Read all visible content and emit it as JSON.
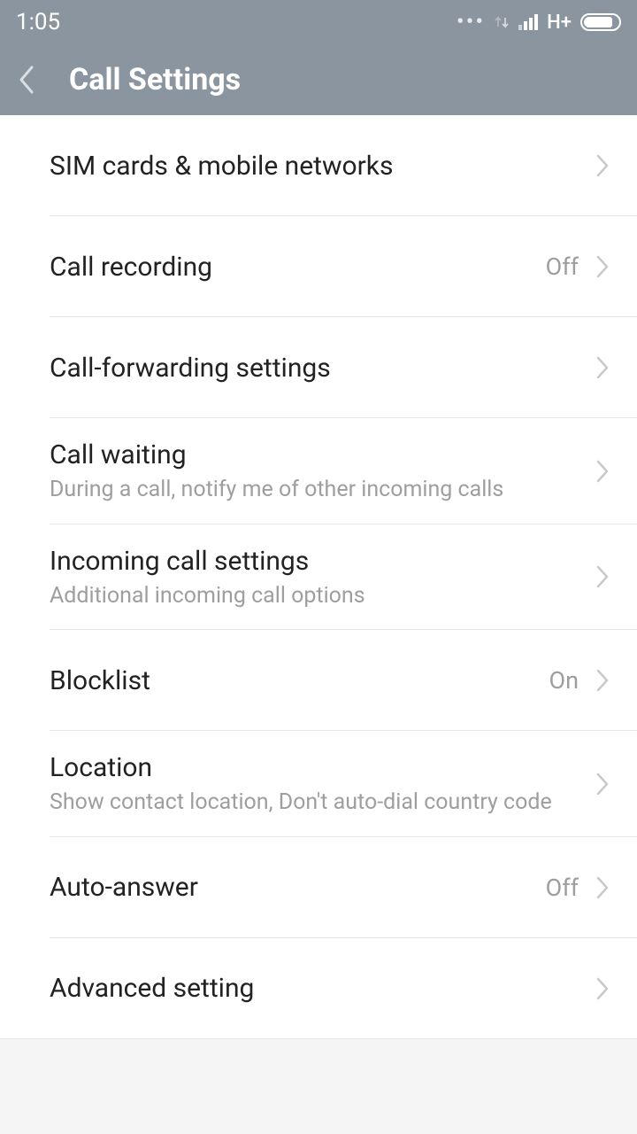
{
  "statusbar": {
    "time": "1:05",
    "net": "H+"
  },
  "header": {
    "title": "Call Settings"
  },
  "rows": [
    {
      "title": "SIM cards & mobile networks",
      "sub": "",
      "value": ""
    },
    {
      "title": "Call recording",
      "sub": "",
      "value": "Off"
    },
    {
      "title": "Call-forwarding settings",
      "sub": "",
      "value": ""
    },
    {
      "title": "Call waiting",
      "sub": "During a call, notify me of other incoming calls",
      "value": ""
    },
    {
      "title": "Incoming call settings",
      "sub": "Additional incoming call options",
      "value": ""
    },
    {
      "title": "Blocklist",
      "sub": "",
      "value": "On"
    },
    {
      "title": "Location",
      "sub": "Show contact location, Don't auto-dial country code",
      "value": ""
    },
    {
      "title": "Auto-answer",
      "sub": "",
      "value": "Off"
    },
    {
      "title": "Advanced setting",
      "sub": "",
      "value": ""
    }
  ]
}
